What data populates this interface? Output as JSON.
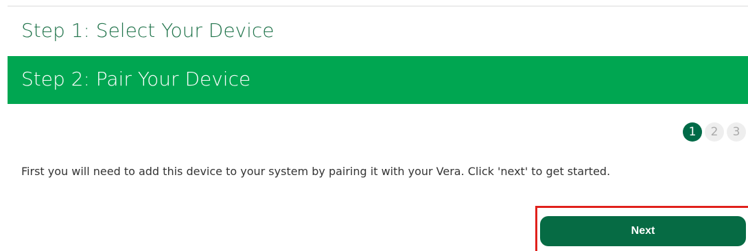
{
  "steps": {
    "step1_title": "Step 1: Select Your Device",
    "step2_title": "Step 2: Pair Your Device"
  },
  "progress": {
    "current": 1,
    "total": 3,
    "labels": [
      "1",
      "2",
      "3"
    ]
  },
  "instruction": "First you will need to add this device to your system by pairing it with your Vera. Click 'next' to get started.",
  "actions": {
    "next_label": "Next"
  },
  "colors": {
    "step2_background": "#00a651",
    "step1_title_text": "#1e7249",
    "active_dot": "#006a47",
    "next_button": "#066b44",
    "highlight_border": "#e0201b"
  }
}
